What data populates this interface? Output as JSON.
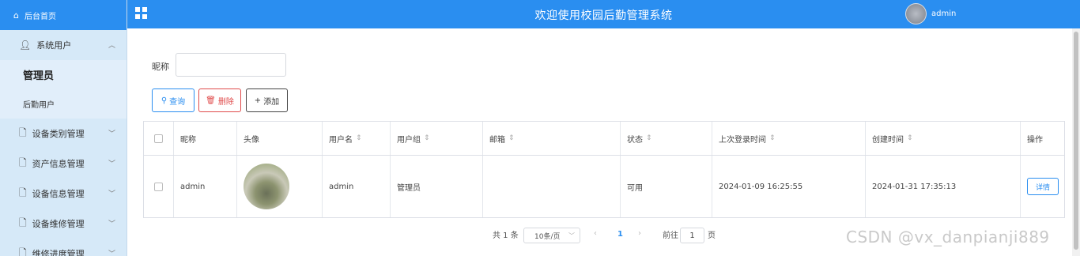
{
  "sidebar": {
    "home": "后台首页",
    "groups": [
      {
        "label": "系统用户"
      },
      {
        "label": "设备类别管理"
      },
      {
        "label": "资产信息管理"
      },
      {
        "label": "设备信息管理"
      },
      {
        "label": "设备维修管理"
      },
      {
        "label": "维修进度管理"
      }
    ],
    "subs": [
      {
        "label": "管理员"
      },
      {
        "label": "后勤用户"
      }
    ]
  },
  "header": {
    "title": "欢迎使用校园后勤管理系统",
    "user": "admin"
  },
  "search": {
    "nickname_label": "昵称",
    "nickname_value": "",
    "query": "查询",
    "delete": "删除",
    "add": "添加"
  },
  "table": {
    "columns": [
      "昵称",
      "头像",
      "用户名",
      "用户组",
      "邮箱",
      "状态",
      "上次登录时间",
      "创建时间",
      "操作"
    ],
    "rows": [
      {
        "nickname": "admin",
        "username": "admin",
        "group": "管理员",
        "email": "",
        "status": "可用",
        "last_login": "2024-01-09 16:25:55",
        "created": "2024-01-31 17:35:13",
        "action": "详情"
      }
    ]
  },
  "pagination": {
    "total": "共 1 条",
    "page_size": "10条/页",
    "current": "1",
    "goto_label": "前往",
    "goto_value": "1",
    "page_unit": "页"
  },
  "watermark": "CSDN @vx_danpianji889",
  "colors": {
    "primary": "#2a8ef0",
    "danger": "#e04b4b",
    "sidebar_bg": "#d6e9f8"
  }
}
